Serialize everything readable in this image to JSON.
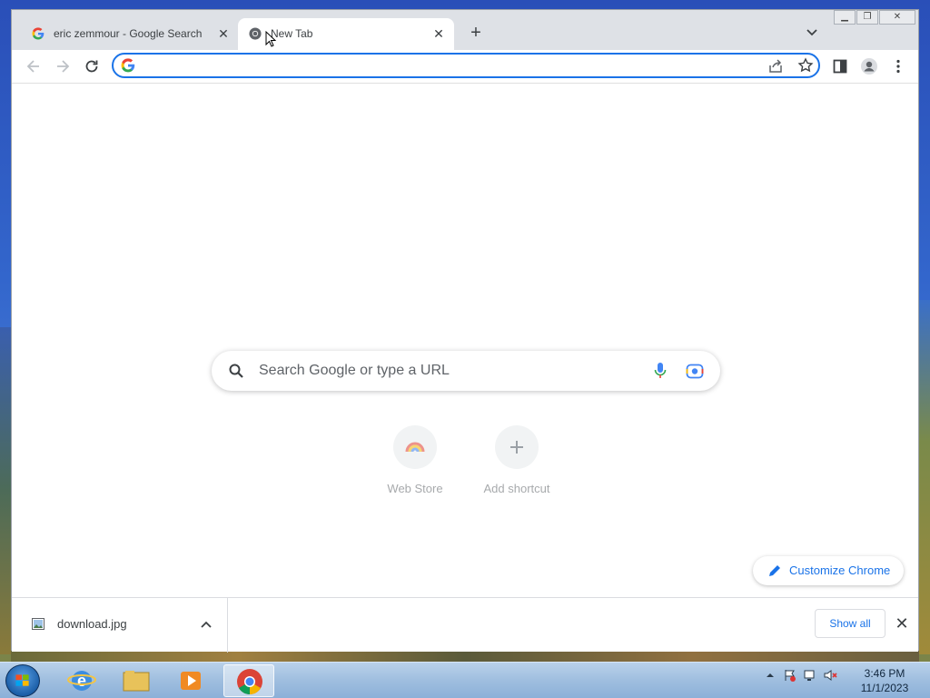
{
  "browser": {
    "tabs": [
      {
        "title": "eric zemmour - Google Search",
        "favicon": "google-g-icon",
        "active": false
      },
      {
        "title": "New Tab",
        "favicon": "chrome-icon",
        "active": true
      }
    ],
    "new_tab_symbol": "+",
    "close_symbol": "✕",
    "omnibox": {
      "value": "",
      "placeholder": ""
    }
  },
  "new_tab_page": {
    "search_placeholder": "Search Google or type a URL",
    "shortcuts": [
      {
        "label": "Web Store",
        "icon": "web-store-icon"
      },
      {
        "label": "Add shortcut",
        "icon": "plus-icon"
      }
    ],
    "customize_label": "Customize Chrome"
  },
  "download_bar": {
    "file_name": "download.jpg",
    "show_all_label": "Show all"
  },
  "taskbar": {
    "time": "3:46 PM",
    "date": "11/1/2023"
  },
  "colors": {
    "accent": "#1a73e8",
    "tabstrip": "#dee1e6",
    "taskbar": "#9fbedf"
  }
}
